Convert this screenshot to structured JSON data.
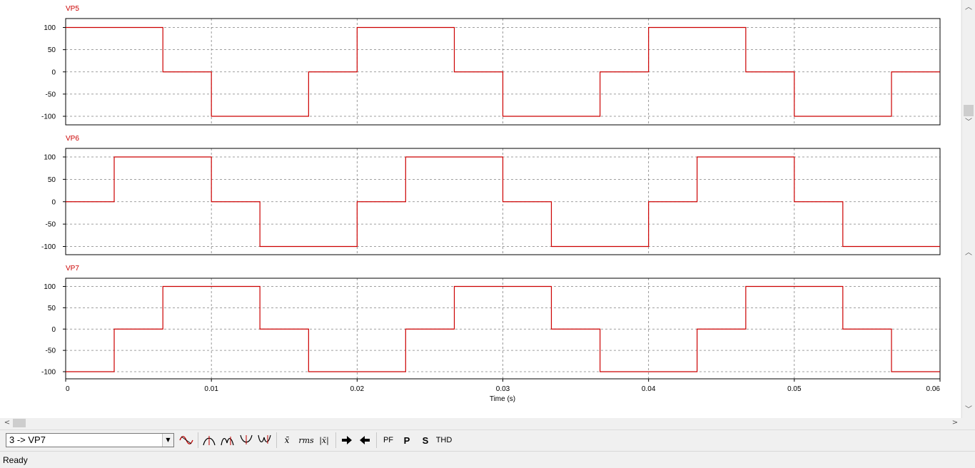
{
  "chart_data": [
    {
      "type": "line",
      "title": "VP5",
      "ylim": [
        -100,
        100
      ],
      "yticks": [
        -100,
        -50,
        0,
        50,
        100
      ],
      "xlim": [
        0,
        0.06
      ],
      "grid": true,
      "color": "#cc0000",
      "points": [
        [
          0,
          100
        ],
        [
          0.00667,
          100
        ],
        [
          0.00667,
          0
        ],
        [
          0.01,
          0
        ],
        [
          0.01,
          -100
        ],
        [
          0.01667,
          -100
        ],
        [
          0.01667,
          0
        ],
        [
          0.02,
          0
        ],
        [
          0.02,
          100
        ],
        [
          0.02667,
          100
        ],
        [
          0.02667,
          0
        ],
        [
          0.03,
          0
        ],
        [
          0.03,
          -100
        ],
        [
          0.03667,
          -100
        ],
        [
          0.03667,
          0
        ],
        [
          0.04,
          0
        ],
        [
          0.04,
          100
        ],
        [
          0.04667,
          100
        ],
        [
          0.04667,
          0
        ],
        [
          0.05,
          0
        ],
        [
          0.05,
          -100
        ],
        [
          0.05667,
          -100
        ],
        [
          0.05667,
          0
        ],
        [
          0.06,
          0
        ]
      ]
    },
    {
      "type": "line",
      "title": "VP6",
      "ylim": [
        -100,
        100
      ],
      "yticks": [
        -100,
        -50,
        0,
        50,
        100
      ],
      "xlim": [
        0,
        0.06
      ],
      "grid": true,
      "color": "#cc0000",
      "points": [
        [
          0,
          0
        ],
        [
          0.00333,
          0
        ],
        [
          0.00333,
          100
        ],
        [
          0.01,
          100
        ],
        [
          0.01,
          0
        ],
        [
          0.01333,
          0
        ],
        [
          0.01333,
          -100
        ],
        [
          0.02,
          -100
        ],
        [
          0.02,
          0
        ],
        [
          0.02333,
          0
        ],
        [
          0.02333,
          100
        ],
        [
          0.03,
          100
        ],
        [
          0.03,
          0
        ],
        [
          0.03333,
          0
        ],
        [
          0.03333,
          -100
        ],
        [
          0.04,
          -100
        ],
        [
          0.04,
          0
        ],
        [
          0.04333,
          0
        ],
        [
          0.04333,
          100
        ],
        [
          0.05,
          100
        ],
        [
          0.05,
          0
        ],
        [
          0.05333,
          0
        ],
        [
          0.05333,
          -100
        ],
        [
          0.06,
          -100
        ]
      ]
    },
    {
      "type": "line",
      "title": "VP7",
      "ylim": [
        -100,
        100
      ],
      "yticks": [
        -100,
        -50,
        0,
        50,
        100
      ],
      "xlim": [
        0,
        0.06
      ],
      "grid": true,
      "color": "#cc0000",
      "points": [
        [
          0,
          -100
        ],
        [
          0.00333,
          -100
        ],
        [
          0.00333,
          0
        ],
        [
          0.00667,
          0
        ],
        [
          0.00667,
          100
        ],
        [
          0.01333,
          100
        ],
        [
          0.01333,
          0
        ],
        [
          0.01667,
          0
        ],
        [
          0.01667,
          -100
        ],
        [
          0.02333,
          -100
        ],
        [
          0.02333,
          0
        ],
        [
          0.02667,
          0
        ],
        [
          0.02667,
          100
        ],
        [
          0.03333,
          100
        ],
        [
          0.03333,
          0
        ],
        [
          0.03667,
          0
        ],
        [
          0.03667,
          -100
        ],
        [
          0.04333,
          -100
        ],
        [
          0.04333,
          0
        ],
        [
          0.04667,
          0
        ],
        [
          0.04667,
          100
        ],
        [
          0.05333,
          100
        ],
        [
          0.05333,
          0
        ],
        [
          0.05667,
          0
        ],
        [
          0.05667,
          -100
        ],
        [
          0.06,
          -100
        ]
      ]
    }
  ],
  "x_axis": {
    "label": "Time (s)",
    "ticks": [
      "0",
      "0.01",
      "0.02",
      "0.03",
      "0.04",
      "0.05",
      "0.06"
    ]
  },
  "toolbar": {
    "selected_signal": "3 -> VP7",
    "mean_label": "x̄",
    "rms_label": "rms",
    "abs_mean_label": "|x̄|",
    "pf_label": "PF",
    "p_label": "P",
    "s_label": "S",
    "thd_label": "THD"
  },
  "status": {
    "text": "Ready"
  },
  "colors": {
    "trace": "#cc0000",
    "title": "#cc0000",
    "grid": "#808080"
  }
}
